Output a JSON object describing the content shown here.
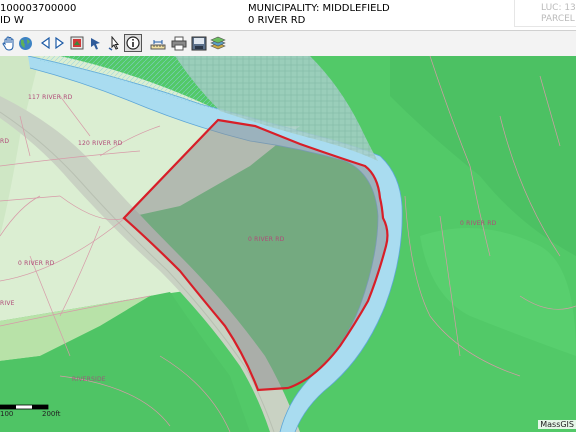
{
  "header": {
    "parcel_id": "100003700000",
    "municipality": "MUNICIPALITY: MIDDLEFIELD",
    "row2_left": "ID W",
    "address": "0 RIVER RD",
    "right_top": "LUC: 13",
    "right_bottom": "PARCEL"
  },
  "toolbar": {
    "tools": [
      "pan-hand",
      "globe",
      "previous-extent",
      "next-extent",
      "zoom-box",
      "select-arrow",
      "select-pointer",
      "identify-info",
      "measure",
      "print",
      "save-map",
      "layers"
    ]
  },
  "map": {
    "labels": {
      "l1": "117 RIVER RD",
      "l2": "120 RIVER RD",
      "l3": "0 RIVER RD",
      "l4": "0 RIVER RD",
      "l5": "0 RIVER RD",
      "l6": "RD",
      "l7": "RIVERSIDE",
      "l8": "RIVE"
    },
    "scale": {
      "left": "100",
      "right": "200ft"
    },
    "attribution": "MassGIS",
    "colors": {
      "forest": "#53cb6a",
      "river": "#a9dbef",
      "wetland": "#9fc7c4",
      "parcel_outline": "#d81e28",
      "parcel_fill": "#8f8f94"
    }
  }
}
